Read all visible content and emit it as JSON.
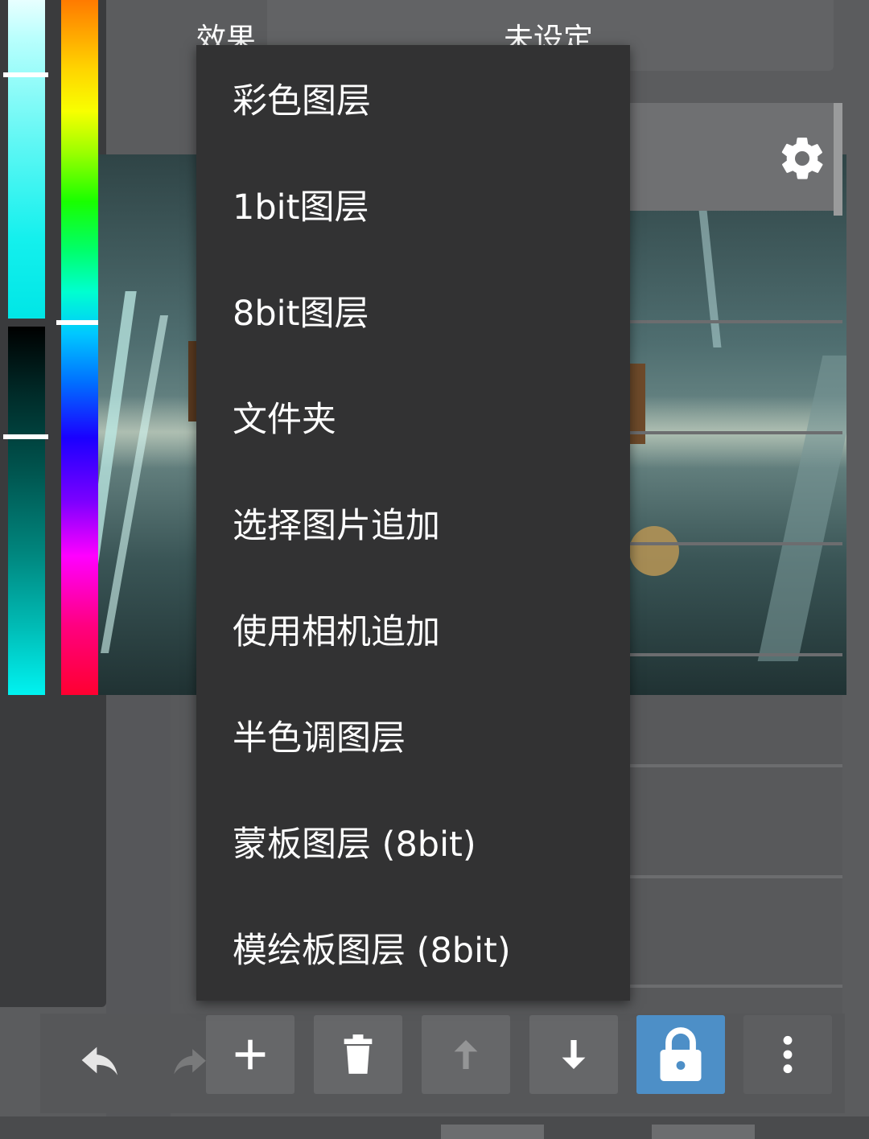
{
  "header": {
    "effect_label": "效果",
    "effect_value": "未设定"
  },
  "add_layer_menu": {
    "items": [
      {
        "label": "彩色图层"
      },
      {
        "label": "1bit图层"
      },
      {
        "label": "8bit图层"
      },
      {
        "label": "文件夹"
      },
      {
        "label": "选择图片追加"
      },
      {
        "label": "使用相机追加"
      },
      {
        "label": "半色调图层"
      },
      {
        "label": "蒙板图层 (8bit)"
      },
      {
        "label": "模绘板图层 (8bit)"
      }
    ]
  },
  "color_picker": {
    "selected_color": "#00f0ee",
    "hue_marker": "cyan"
  },
  "toolbar": {
    "icons": [
      "undo-icon",
      "redo-icon",
      "plus-icon",
      "trash-icon",
      "arrow-up-icon",
      "arrow-down-icon",
      "lock-icon",
      "more-vertical-icon"
    ]
  },
  "colors": {
    "menu_background": "#323233",
    "lock_accent": "#4d8fc7",
    "panel": "#5b5c5e"
  }
}
